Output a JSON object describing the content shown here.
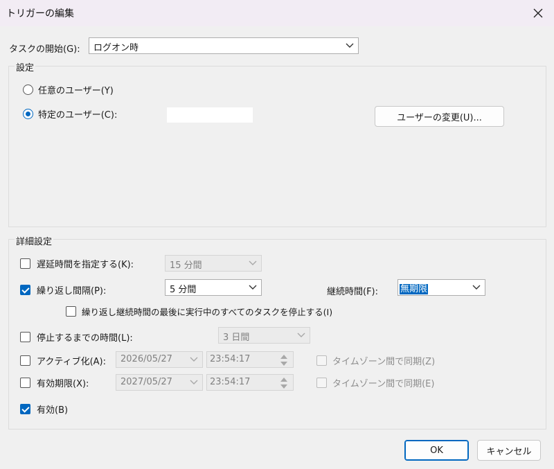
{
  "window": {
    "title": "トリガーの編集"
  },
  "begin_task": {
    "label": "タスクの開始(G):",
    "value": "ログオン時"
  },
  "settings": {
    "group_title": "設定",
    "any_user_label": "任意のユーザー(Y)",
    "specific_user_label": "特定のユーザー(C):",
    "change_user_button": "ユーザーの変更(U)..."
  },
  "advanced": {
    "group_title": "詳細設定",
    "delay": {
      "label": "遅延時間を指定する(K):",
      "value": "15 分間",
      "checked": false
    },
    "repeat": {
      "label": "繰り返し間隔(P):",
      "value": "5 分間",
      "checked": true
    },
    "duration": {
      "label": "継続時間(F):",
      "value": "無期限"
    },
    "stop_all": {
      "label": "繰り返し継続時間の最後に実行中のすべてのタスクを停止する(I)",
      "checked": false
    },
    "stop_after": {
      "label": "停止するまでの時間(L):",
      "value": "3 日間",
      "checked": false
    },
    "activate": {
      "label": "アクティブ化(A):",
      "date": "2026/05/27",
      "time": "23:54:17",
      "sync_label": "タイムゾーン間で同期(Z)",
      "checked": false
    },
    "expire": {
      "label": "有効期限(X):",
      "date": "2027/05/27",
      "time": "23:54:17",
      "sync_label": "タイムゾーン間で同期(E)",
      "checked": false
    },
    "enabled": {
      "label": "有効(B)",
      "checked": true
    }
  },
  "buttons": {
    "ok": "OK",
    "cancel": "キャンセル"
  },
  "colors": {
    "accent": "#0067c0",
    "titlebar": "#f2ecf4"
  }
}
